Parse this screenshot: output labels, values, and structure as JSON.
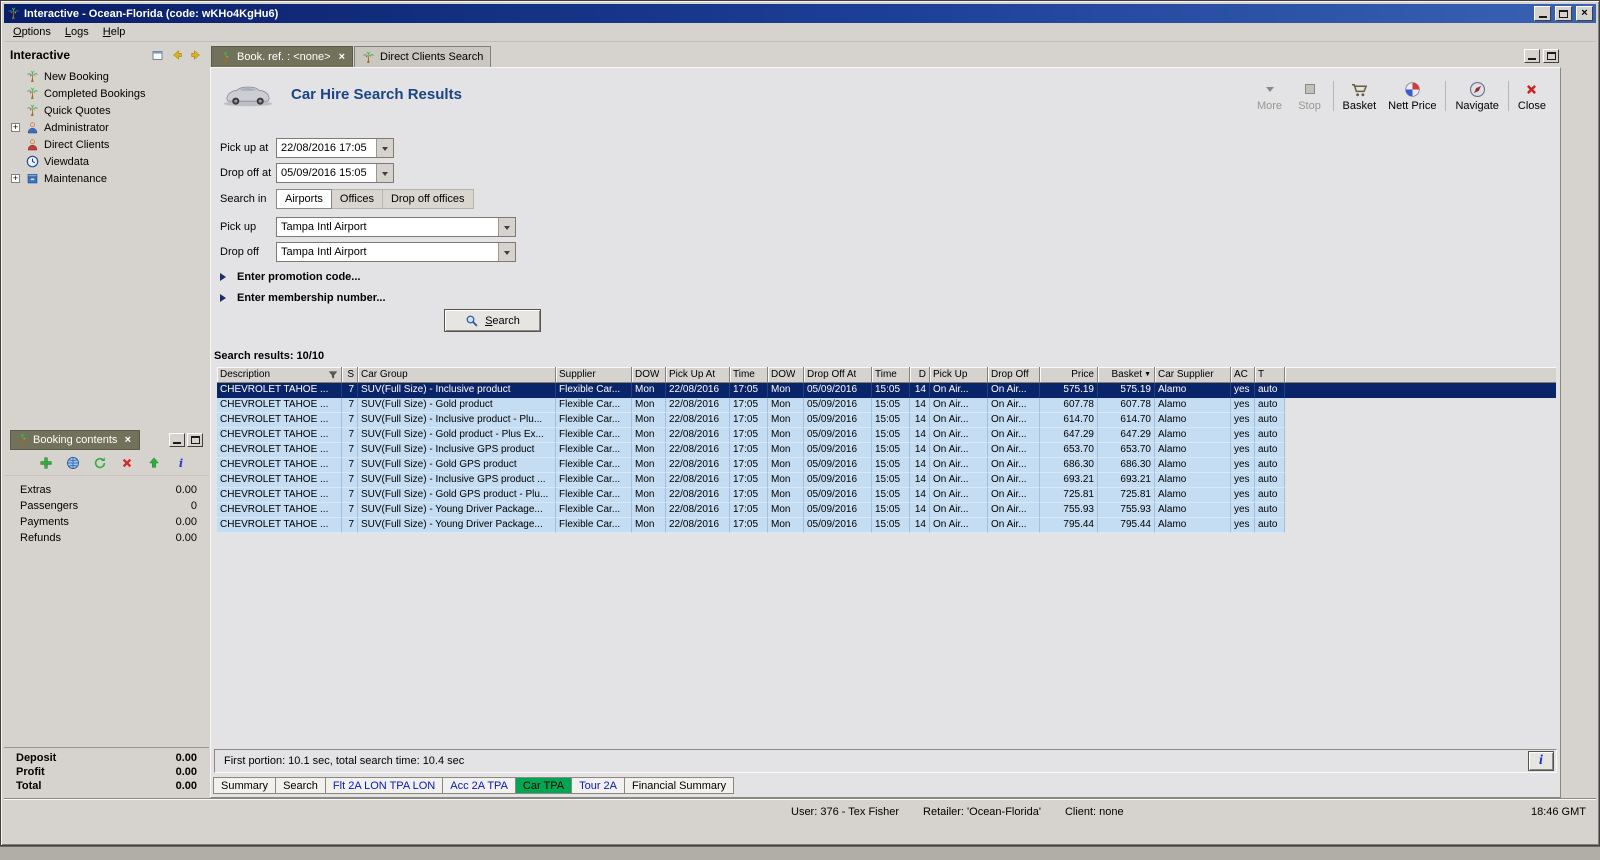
{
  "window": {
    "title": "Interactive - Ocean-Florida (code: wKHo4KgHu6)",
    "menu": [
      "Options",
      "Logs",
      "Help"
    ]
  },
  "sidebar": {
    "title": "Interactive",
    "items": [
      {
        "label": "New Booking",
        "icon": "palm-icon",
        "expandable": false
      },
      {
        "label": "Completed Bookings",
        "icon": "palm-icon",
        "expandable": false
      },
      {
        "label": "Quick Quotes",
        "icon": "palm-icon",
        "expandable": false
      },
      {
        "label": "Administrator",
        "icon": "person-blue-icon",
        "expandable": true
      },
      {
        "label": "Direct Clients",
        "icon": "person-red-icon",
        "expandable": false
      },
      {
        "label": "Viewdata",
        "icon": "clock-icon",
        "expandable": false
      },
      {
        "label": "Maintenance",
        "icon": "box-icon",
        "expandable": true
      }
    ]
  },
  "booking_contents": {
    "title": "Booking contents",
    "toolbar": [
      "add-icon",
      "globe-icon",
      "refresh-icon",
      "delete-icon",
      "up-icon",
      "info-icon"
    ],
    "rows": [
      {
        "label": "Extras",
        "value": "0.00"
      },
      {
        "label": "Passengers",
        "value": "0"
      },
      {
        "label": "Payments",
        "value": "0.00"
      },
      {
        "label": "Refunds",
        "value": "0.00"
      }
    ],
    "totals": [
      {
        "label": "Deposit",
        "value": "0.00"
      },
      {
        "label": "Profit",
        "value": "0.00"
      },
      {
        "label": "Total",
        "value": "0.00"
      }
    ]
  },
  "tabs": [
    {
      "label": "Book. ref. : <none>",
      "active": true,
      "closable": true
    },
    {
      "label": "Direct Clients Search",
      "active": false,
      "closable": false
    }
  ],
  "main": {
    "title": "Car Hire Search Results",
    "toolbar": [
      {
        "label": "More",
        "icon": "more-icon",
        "disabled": true
      },
      {
        "label": "Stop",
        "icon": "stop-icon",
        "disabled": true
      },
      {
        "label": "Basket",
        "icon": "basket-icon",
        "separator_before": true
      },
      {
        "label": "Nett Price",
        "icon": "nett-price-icon"
      },
      {
        "label": "Navigate",
        "icon": "navigate-icon",
        "separator_before": true
      },
      {
        "label": "Close",
        "icon": "close-red-icon",
        "separator_before": true
      }
    ],
    "form": {
      "pickup_at_label": "Pick up at",
      "pickup_at_value": "22/08/2016 17:05",
      "dropoff_at_label": "Drop off at",
      "dropoff_at_value": "05/09/2016 15:05",
      "search_in_label": "Search in",
      "search_in_tabs": [
        "Airports",
        "Offices",
        "Drop off offices"
      ],
      "search_in_active": 0,
      "pickup_label": "Pick up",
      "pickup_value": "Tampa Intl Airport",
      "dropoff_label": "Drop off",
      "dropoff_value": "Tampa Intl Airport",
      "promo_code": "Enter promotion code...",
      "membership": "Enter membership number...",
      "search_button": "Search"
    },
    "results_label": "Search results: 10/10",
    "table": {
      "columns": [
        "Description",
        "S",
        "Car Group",
        "Supplier",
        "DOW",
        "Pick Up At",
        "Time",
        "DOW",
        "Drop Off At",
        "Time",
        "D",
        "Pick Up",
        "Drop Off",
        "Price",
        "Basket",
        "Car Supplier",
        "AC",
        "T"
      ],
      "selected_row_index": 0,
      "rows": [
        [
          "CHEVROLET TAHOE ...",
          "7",
          "SUV(Full Size) - Inclusive product",
          "Flexible Car...",
          "Mon",
          "22/08/2016",
          "17:05",
          "Mon",
          "05/09/2016",
          "15:05",
          "14",
          "On Air...",
          "On Air...",
          "575.19",
          "575.19",
          "Alamo",
          "yes",
          "auto"
        ],
        [
          "CHEVROLET TAHOE ...",
          "7",
          "SUV(Full Size) - Gold product",
          "Flexible Car...",
          "Mon",
          "22/08/2016",
          "17:05",
          "Mon",
          "05/09/2016",
          "15:05",
          "14",
          "On Air...",
          "On Air...",
          "607.78",
          "607.78",
          "Alamo",
          "yes",
          "auto"
        ],
        [
          "CHEVROLET TAHOE ...",
          "7",
          "SUV(Full Size) - Inclusive product - Plu...",
          "Flexible Car...",
          "Mon",
          "22/08/2016",
          "17:05",
          "Mon",
          "05/09/2016",
          "15:05",
          "14",
          "On Air...",
          "On Air...",
          "614.70",
          "614.70",
          "Alamo",
          "yes",
          "auto"
        ],
        [
          "CHEVROLET TAHOE ...",
          "7",
          "SUV(Full Size) - Gold product - Plus Ex...",
          "Flexible Car...",
          "Mon",
          "22/08/2016",
          "17:05",
          "Mon",
          "05/09/2016",
          "15:05",
          "14",
          "On Air...",
          "On Air...",
          "647.29",
          "647.29",
          "Alamo",
          "yes",
          "auto"
        ],
        [
          "CHEVROLET TAHOE ...",
          "7",
          "SUV(Full Size) - Inclusive GPS product",
          "Flexible Car...",
          "Mon",
          "22/08/2016",
          "17:05",
          "Mon",
          "05/09/2016",
          "15:05",
          "14",
          "On Air...",
          "On Air...",
          "653.70",
          "653.70",
          "Alamo",
          "yes",
          "auto"
        ],
        [
          "CHEVROLET TAHOE ...",
          "7",
          "SUV(Full Size) - Gold GPS product",
          "Flexible Car...",
          "Mon",
          "22/08/2016",
          "17:05",
          "Mon",
          "05/09/2016",
          "15:05",
          "14",
          "On Air...",
          "On Air...",
          "686.30",
          "686.30",
          "Alamo",
          "yes",
          "auto"
        ],
        [
          "CHEVROLET TAHOE ...",
          "7",
          "SUV(Full Size) - Inclusive GPS product ...",
          "Flexible Car...",
          "Mon",
          "22/08/2016",
          "17:05",
          "Mon",
          "05/09/2016",
          "15:05",
          "14",
          "On Air...",
          "On Air...",
          "693.21",
          "693.21",
          "Alamo",
          "yes",
          "auto"
        ],
        [
          "CHEVROLET TAHOE ...",
          "7",
          "SUV(Full Size) - Gold GPS product - Plu...",
          "Flexible Car...",
          "Mon",
          "22/08/2016",
          "17:05",
          "Mon",
          "05/09/2016",
          "15:05",
          "14",
          "On Air...",
          "On Air...",
          "725.81",
          "725.81",
          "Alamo",
          "yes",
          "auto"
        ],
        [
          "CHEVROLET TAHOE ...",
          "7",
          "SUV(Full Size) - Young Driver Package...",
          "Flexible Car...",
          "Mon",
          "22/08/2016",
          "17:05",
          "Mon",
          "05/09/2016",
          "15:05",
          "14",
          "On Air...",
          "On Air...",
          "755.93",
          "755.93",
          "Alamo",
          "yes",
          "auto"
        ],
        [
          "CHEVROLET TAHOE ...",
          "7",
          "SUV(Full Size) - Young Driver Package...",
          "Flexible Car...",
          "Mon",
          "22/08/2016",
          "17:05",
          "Mon",
          "05/09/2016",
          "15:05",
          "14",
          "On Air...",
          "On Air...",
          "795.44",
          "795.44",
          "Alamo",
          "yes",
          "auto"
        ]
      ]
    },
    "status": "First portion: 10.1 sec, total search time: 10.4 sec",
    "bottom_tabs": [
      {
        "label": "Summary",
        "style": "plain"
      },
      {
        "label": "Search",
        "style": "plain"
      },
      {
        "label": "Flt 2A LON TPA LON",
        "style": "blue"
      },
      {
        "label": "Acc 2A TPA",
        "style": "blue"
      },
      {
        "label": "Car TPA",
        "style": "green"
      },
      {
        "label": "Tour 2A",
        "style": "blue"
      },
      {
        "label": "Financial Summary",
        "style": "plain"
      }
    ]
  },
  "statusbar": {
    "user": "User: 376 - Tex Fisher",
    "retailer": "Retailer: 'Ocean-Florida'",
    "client": "Client: none",
    "time": "18:46 GMT"
  }
}
